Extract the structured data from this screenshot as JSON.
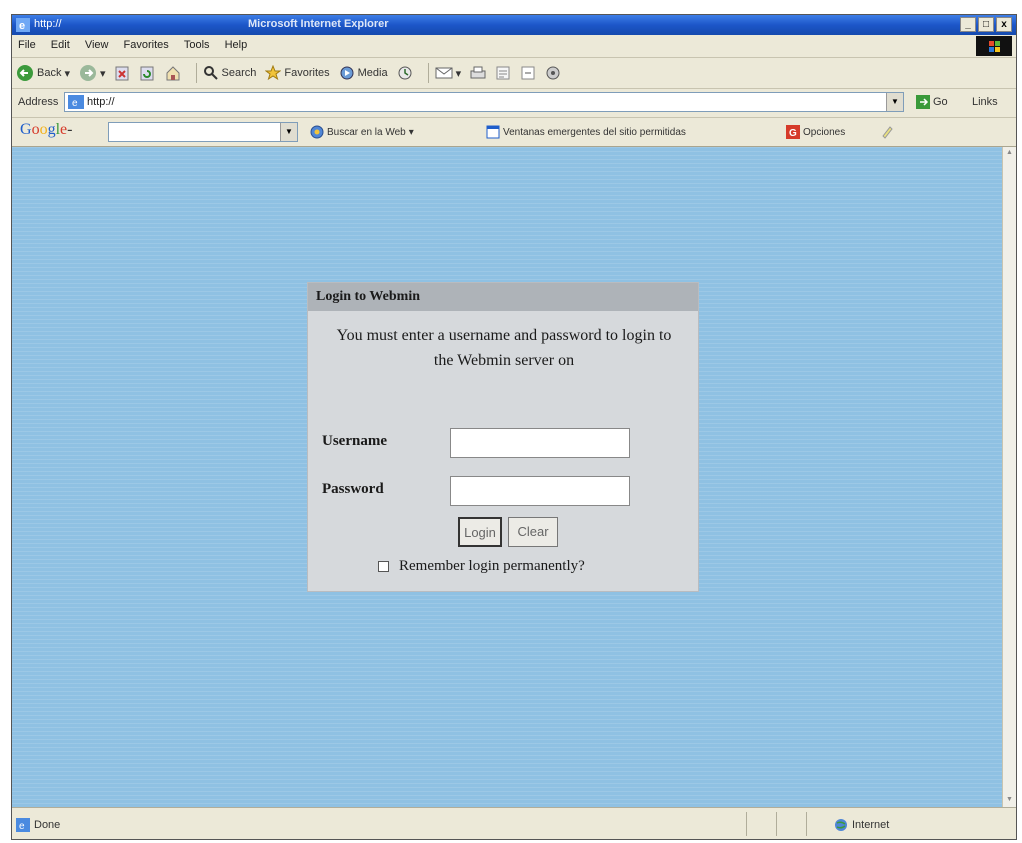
{
  "window": {
    "title_url": "http://",
    "app_title": "Microsoft Internet Explorer",
    "min_label": "_",
    "max_label": "□",
    "close_label": "x"
  },
  "menubar": {
    "items": [
      "File",
      "Edit",
      "View",
      "Favorites",
      "Tools",
      "Help"
    ]
  },
  "toolbar": {
    "back_label": "Back",
    "search_label": "Search",
    "favorites_label": "Favorites",
    "media_label": "Media"
  },
  "addressbar": {
    "label": "Address",
    "value": "http://",
    "go_label": "Go",
    "links_label": "Links"
  },
  "googlebar": {
    "logo": "Google",
    "search_web_label": "Buscar en la Web",
    "popup_blocker_label": "Ventanas emergentes del sitio permitidas",
    "options_label": "Opciones"
  },
  "login": {
    "title": "Login to Webmin",
    "message": "You must enter a username and password to login to the Webmin server on",
    "username_label": "Username",
    "password_label": "Password",
    "username_value": "",
    "password_value": "",
    "login_button": "Login",
    "clear_button": "Clear",
    "remember_label": "Remember login permanently?"
  },
  "statusbar": {
    "status": "Done",
    "zone": "Internet"
  },
  "colors": {
    "page_background": "#8fc1e3",
    "login_box": "#d6d9dc",
    "login_header": "#aeb3b8",
    "titlebar": "#1c56c8"
  }
}
